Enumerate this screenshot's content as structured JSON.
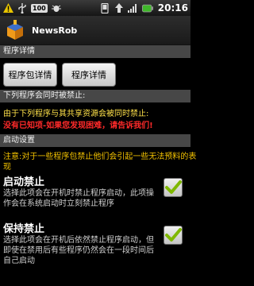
{
  "status_bar": {
    "notification_count": "100",
    "time": "20:16"
  },
  "app": {
    "name": "NewsRob"
  },
  "section_program_details": {
    "header": "程序详情",
    "buttons": [
      "程序包详情",
      "程序详情"
    ]
  },
  "section_blocked": {
    "header": "下列程序会同时被禁止:",
    "notice_line": "由于下列程序与其共享资源会被同时禁止:",
    "warning_line": "没有已知项-如果您发现困难，请告诉我们!"
  },
  "section_startup": {
    "header": "启动设置",
    "caution_line1": "注意:对于一些程序包禁止他们会引起一些无法预料的表",
    "caution_line2": "现"
  },
  "prefs": [
    {
      "title": "启动禁止",
      "description": "选择此项会在开机时禁止程序启动，此项操作会在系统启动时立刻禁止程序",
      "checked": true
    },
    {
      "title": "保持禁止",
      "description": "选择此项会在开机后依然禁止程序启动，但即使在禁用后有些程序仍然会在一段时间后自己启动",
      "checked": true
    }
  ],
  "colors": {
    "warning_text": "#ff2a2a",
    "notice_text": "#ffe24a",
    "caution_text": "#f4c300",
    "check_mark": "#7fb800"
  }
}
